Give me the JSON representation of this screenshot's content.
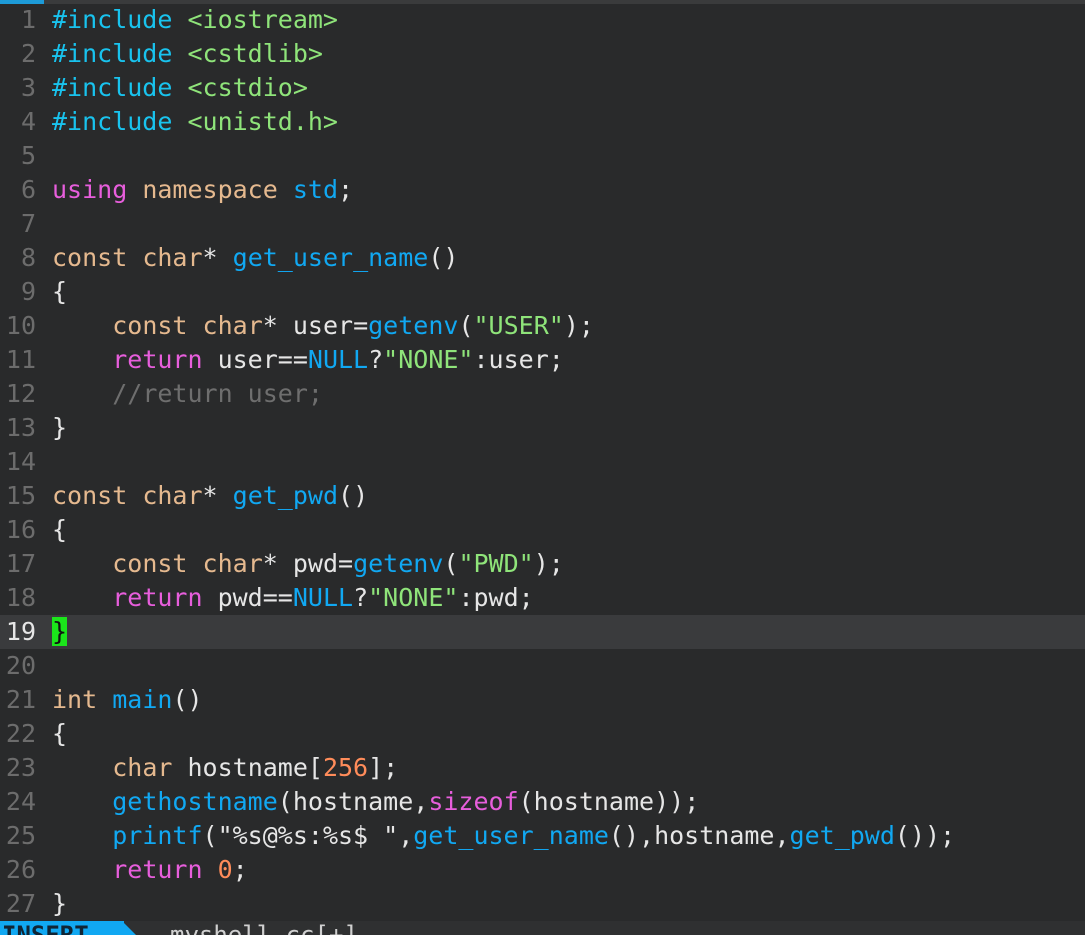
{
  "editor": {
    "mode": "INSERT",
    "filename": "myshell.cc[+]",
    "cursor_line": 19,
    "colors": {
      "background": "#292a2b",
      "keyword": "#e75edc",
      "type": "#e5b98f",
      "function": "#11a8f2",
      "string": "#8fe47a",
      "number": "#ff8c5a",
      "comment": "#6e6e6e",
      "cursor": "#1be51b"
    }
  },
  "lines": [
    {
      "n": "1",
      "tokens": [
        [
          "pre",
          "#include "
        ],
        [
          "inc",
          "<iostream>"
        ]
      ]
    },
    {
      "n": "2",
      "tokens": [
        [
          "pre",
          "#include "
        ],
        [
          "inc",
          "<cstdlib>"
        ]
      ]
    },
    {
      "n": "3",
      "tokens": [
        [
          "pre",
          "#include "
        ],
        [
          "inc",
          "<cstdio>"
        ]
      ]
    },
    {
      "n": "4",
      "tokens": [
        [
          "pre",
          "#include "
        ],
        [
          "inc",
          "<unistd.h>"
        ]
      ]
    },
    {
      "n": "5",
      "tokens": []
    },
    {
      "n": "6",
      "tokens": [
        [
          "kw",
          "using"
        ],
        [
          "op",
          " "
        ],
        [
          "ty",
          "namespace"
        ],
        [
          "op",
          " "
        ],
        [
          "fn",
          "std"
        ],
        [
          "op",
          ";"
        ]
      ]
    },
    {
      "n": "7",
      "tokens": []
    },
    {
      "n": "8",
      "tokens": [
        [
          "ty",
          "const"
        ],
        [
          "op",
          " "
        ],
        [
          "ty",
          "char"
        ],
        [
          "op",
          "* "
        ],
        [
          "fn",
          "get_user_name"
        ],
        [
          "op",
          "()"
        ]
      ]
    },
    {
      "n": "9",
      "tokens": [
        [
          "op",
          "{"
        ]
      ]
    },
    {
      "n": "10",
      "tokens": [
        [
          "op",
          "    "
        ],
        [
          "ty",
          "const"
        ],
        [
          "op",
          " "
        ],
        [
          "ty",
          "char"
        ],
        [
          "op",
          "* user="
        ],
        [
          "fn",
          "getenv"
        ],
        [
          "op",
          "("
        ],
        [
          "str",
          "\"USER\""
        ],
        [
          "op",
          ");"
        ]
      ]
    },
    {
      "n": "11",
      "tokens": [
        [
          "op",
          "    "
        ],
        [
          "kw",
          "return"
        ],
        [
          "op",
          " user=="
        ],
        [
          "fn",
          "NULL"
        ],
        [
          "op",
          "?"
        ],
        [
          "str",
          "\"NONE\""
        ],
        [
          "op",
          ":user;"
        ]
      ]
    },
    {
      "n": "12",
      "tokens": [
        [
          "op",
          "    "
        ],
        [
          "cm",
          "//return user;"
        ]
      ]
    },
    {
      "n": "13",
      "tokens": [
        [
          "op",
          "}"
        ]
      ]
    },
    {
      "n": "14",
      "tokens": []
    },
    {
      "n": "15",
      "tokens": [
        [
          "ty",
          "const"
        ],
        [
          "op",
          " "
        ],
        [
          "ty",
          "char"
        ],
        [
          "op",
          "* "
        ],
        [
          "fn",
          "get_pwd"
        ],
        [
          "op",
          "()"
        ]
      ]
    },
    {
      "n": "16",
      "tokens": [
        [
          "op",
          "{"
        ]
      ]
    },
    {
      "n": "17",
      "tokens": [
        [
          "op",
          "    "
        ],
        [
          "ty",
          "const"
        ],
        [
          "op",
          " "
        ],
        [
          "ty",
          "char"
        ],
        [
          "op",
          "* pwd="
        ],
        [
          "fn",
          "getenv"
        ],
        [
          "op",
          "("
        ],
        [
          "str",
          "\"PWD\""
        ],
        [
          "op",
          ");"
        ]
      ]
    },
    {
      "n": "18",
      "tokens": [
        [
          "op",
          "    "
        ],
        [
          "kw",
          "return"
        ],
        [
          "op",
          " pwd=="
        ],
        [
          "fn",
          "NULL"
        ],
        [
          "op",
          "?"
        ],
        [
          "str",
          "\"NONE\""
        ],
        [
          "op",
          ":pwd;"
        ]
      ]
    },
    {
      "n": "19",
      "tokens": [
        [
          "cursor",
          "}"
        ]
      ]
    },
    {
      "n": "20",
      "tokens": []
    },
    {
      "n": "21",
      "tokens": [
        [
          "ty",
          "int"
        ],
        [
          "op",
          " "
        ],
        [
          "fn",
          "main"
        ],
        [
          "op",
          "()"
        ]
      ]
    },
    {
      "n": "22",
      "tokens": [
        [
          "op",
          "{"
        ]
      ]
    },
    {
      "n": "23",
      "tokens": [
        [
          "op",
          "    "
        ],
        [
          "ty",
          "char"
        ],
        [
          "op",
          " hostname["
        ],
        [
          "num",
          "256"
        ],
        [
          "op",
          "];"
        ]
      ]
    },
    {
      "n": "24",
      "tokens": [
        [
          "op",
          "    "
        ],
        [
          "fn",
          "gethostname"
        ],
        [
          "op",
          "(hostname,"
        ],
        [
          "kw",
          "sizeof"
        ],
        [
          "op",
          "(hostname));"
        ]
      ]
    },
    {
      "n": "25",
      "tokens": [
        [
          "op",
          "    "
        ],
        [
          "fn",
          "printf"
        ],
        [
          "op",
          "(\"%s@%s:%s$ \","
        ],
        [
          "fn",
          "get_user_name"
        ],
        [
          "op",
          "(),hostname,"
        ],
        [
          "fn",
          "get_pwd"
        ],
        [
          "op",
          "());"
        ]
      ]
    },
    {
      "n": "26",
      "tokens": [
        [
          "op",
          "    "
        ],
        [
          "kw",
          "return"
        ],
        [
          "op",
          " "
        ],
        [
          "num",
          "0"
        ],
        [
          "op",
          ";"
        ]
      ]
    },
    {
      "n": "27",
      "tokens": [
        [
          "op",
          "}"
        ]
      ]
    }
  ]
}
